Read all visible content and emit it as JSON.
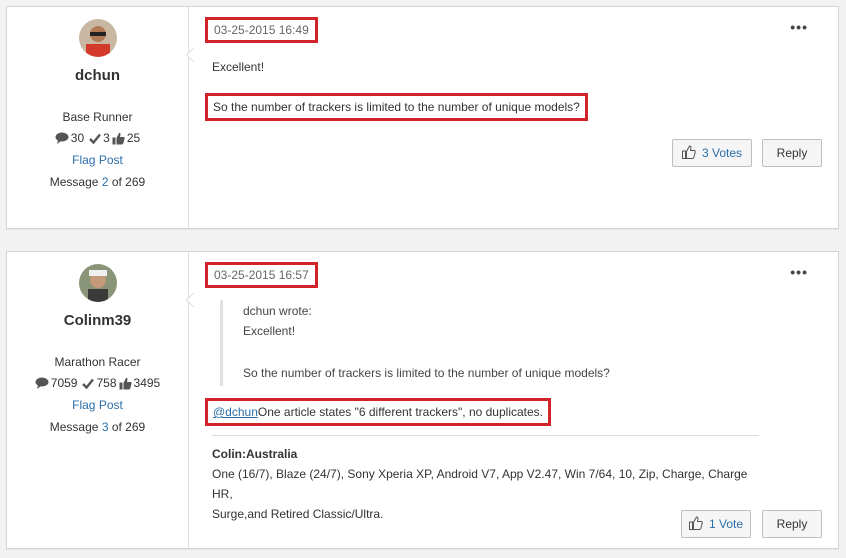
{
  "posts": [
    {
      "author": {
        "name": "dchun",
        "rank": "Base Runner",
        "replies": "30",
        "solutions": "3",
        "kudos": "25"
      },
      "flag_label": "Flag Post",
      "message_prefix": "Message",
      "message_number": "2",
      "message_of": "of 269",
      "timestamp": "03-25-2015 16:49",
      "body_line1": "Excellent!",
      "body_line2": "So the number of trackers is limited to the number of unique models?",
      "votes_label": "3 Votes",
      "reply_label": "Reply"
    },
    {
      "author": {
        "name": "Colinm39",
        "rank": "Marathon Racer",
        "replies": "7059",
        "solutions": "758",
        "kudos": "3495"
      },
      "flag_label": "Flag Post",
      "message_prefix": "Message",
      "message_number": "3",
      "message_of": "of 269",
      "timestamp": "03-25-2015 16:57",
      "quote": {
        "author_line": "dchun wrote:",
        "line1": "Excellent!",
        "line2": "So the number of trackers is limited to the number of unique models?"
      },
      "mention": "@dchun",
      "body_text": "One article states \"6 different trackers\", no duplicates.",
      "signature": {
        "name": "Colin:Australia",
        "line1": "One (16/7), Blaze (24/7), Sony Xperia XP, Android V7, App V2.47, Win 7/64, 10, Zip, Charge, Charge HR,",
        "line2": "Surge,and Retired Classic/Ultra."
      },
      "votes_label": "1 Vote",
      "reply_label": "Reply"
    }
  ],
  "colors": {
    "highlight": "#d2232a",
    "link": "#2a6ea8"
  },
  "icons": [
    "speech-bubble-icon",
    "checkmark-icon",
    "thumbs-up-icon",
    "more-options-icon"
  ]
}
